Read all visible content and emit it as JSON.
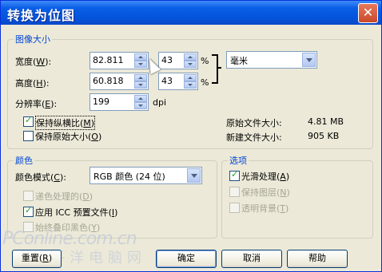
{
  "window": {
    "title": "转换为位图",
    "close_glyph": "✕"
  },
  "image_size": {
    "legend": "图像大小",
    "width_label": "宽度(",
    "width_key": "W",
    "width_suffix": "):",
    "width_value": "82.811",
    "width_percent": "43",
    "height_label": "高度(",
    "height_key": "H",
    "height_suffix": "):",
    "height_value": "60.818",
    "height_percent": "43",
    "percent_sign": "%",
    "unit": "毫米",
    "resolution_label": "分辨率(",
    "resolution_key": "E",
    "resolution_suffix": "):",
    "resolution_value": "199",
    "resolution_unit": "dpi",
    "keep_ratio_label": "保持纵横比(",
    "keep_ratio_key": "M",
    "keep_ratio_suffix": ")",
    "keep_ratio_checked": true,
    "keep_size_label": "保持原始大小(",
    "keep_size_key": "O",
    "keep_size_suffix": ")",
    "keep_size_checked": false,
    "orig_size_label": "原始文件大小:",
    "orig_size_value": "4.81 MB",
    "new_size_label": "新建文件大小:",
    "new_size_value": "905 KB"
  },
  "color": {
    "legend": "颜色",
    "mode_label": "颜色模式(",
    "mode_key": "C",
    "mode_suffix": "):",
    "mode_value": "RGB 颜色 (24 位)",
    "dither_label": "递色处理的(",
    "dither_key": "D",
    "dither_suffix": ")",
    "dither_checked": false,
    "dither_enabled": false,
    "icc_label": "应用 ICC 预置文件(",
    "icc_key": "I",
    "icc_suffix": ")",
    "icc_checked": true,
    "overprint_label": "始终叠印黑色(",
    "overprint_key": "Y",
    "overprint_suffix": ")",
    "overprint_checked": false,
    "overprint_enabled": false
  },
  "options": {
    "legend": "选项",
    "smooth_label": "光滑处理(",
    "smooth_key": "A",
    "smooth_suffix": ")",
    "smooth_checked": true,
    "keep_layers_label": "保持图层(",
    "keep_layers_key": "N",
    "keep_layers_suffix": ")",
    "keep_layers_enabled": false,
    "transparent_label": "透明背景(",
    "transparent_key": "T",
    "transparent_suffix": ")",
    "transparent_enabled": false
  },
  "buttons": {
    "reset_label": "重置(",
    "reset_key": "R",
    "reset_suffix": ")",
    "ok": "确定",
    "cancel": "取消",
    "help": "帮助"
  },
  "watermark": {
    "brand": "PConline.com.cn",
    "subtitle": "太平洋电脑网"
  }
}
